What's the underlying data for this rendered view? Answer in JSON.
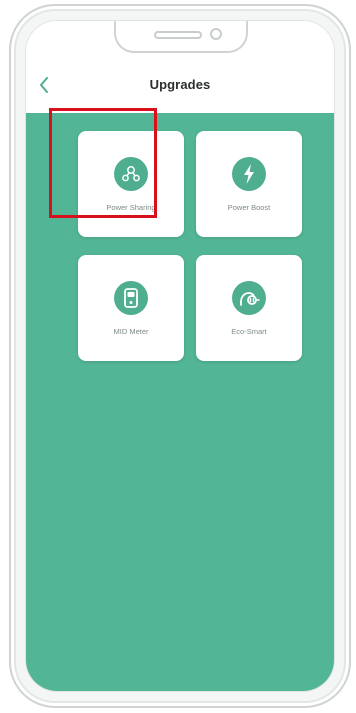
{
  "header": {
    "title": "Upgrades",
    "back_icon": "chevron-left-icon"
  },
  "tiles": [
    {
      "label": "Power Sharing",
      "icon": "power-sharing-icon"
    },
    {
      "label": "Power Boost",
      "icon": "lightning-bolt-icon"
    },
    {
      "label": "MID Meter",
      "icon": "meter-icon"
    },
    {
      "label": "Eco-Smart",
      "icon": "eco-smart-plug-icon"
    }
  ],
  "colors": {
    "accent_green": "#52b596",
    "icon_green": "#4fae8f",
    "highlight_red": "#d8101b",
    "tile_background": "#ffffff"
  }
}
